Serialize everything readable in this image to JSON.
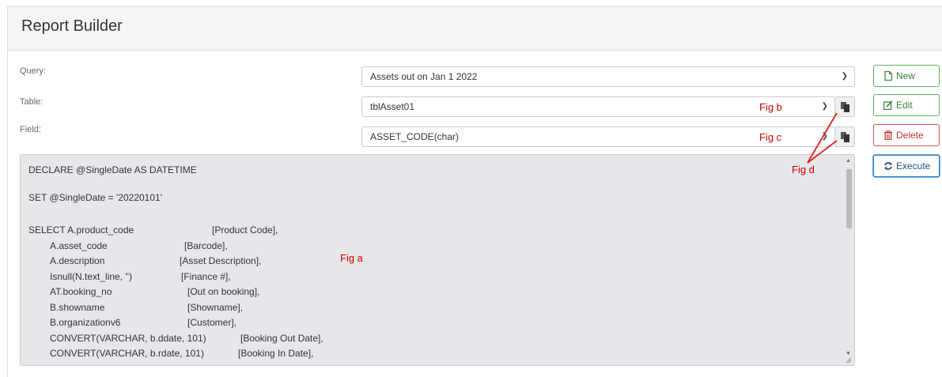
{
  "panel": {
    "title": "Report Builder"
  },
  "form": {
    "query_label": "Query:",
    "query_value": "Assets out on Jan 1 2022",
    "table_label": "Table:",
    "table_value": "tblAsset01",
    "field_label": "Field:",
    "field_value": "ASSET_CODE(char)"
  },
  "buttons": {
    "new": "New",
    "edit": "Edit",
    "delete": "Delete",
    "execute": "Execute"
  },
  "annotations": {
    "fig_a": "Fig a",
    "fig_b": "Fig b",
    "fig_c": "Fig c",
    "fig_d": "Fig d"
  },
  "code": {
    "lines": [
      {
        "col1": "DECLARE @SingleDate AS DATETIME",
        "col2": ""
      },
      {
        "col1": "SET @SingleDate = '20220101'",
        "col2": ""
      },
      {
        "col1": "SELECT A.product_code",
        "col2": "[Product Code],"
      },
      {
        "col1": "A.asset_code",
        "col2": "[Barcode],"
      },
      {
        "col1": "A.description",
        "col2": "[Asset Description],"
      },
      {
        "col1": "Isnull(N.text_line, '')",
        "col2": "[Finance #],"
      },
      {
        "col1": "AT.booking_no",
        "col2": "[Out on booking],"
      },
      {
        "col1": "B.showname",
        "col2": "[Showname],"
      },
      {
        "col1": "B.organizationv6",
        "col2": "[Customer],"
      },
      {
        "col1": "CONVERT(VARCHAR, b.ddate, 101)",
        "col2": "[Booking Out Date],"
      },
      {
        "col1": "CONVERT(VARCHAR, b.rdate, 101)",
        "col2": "[Booking In Date],"
      }
    ]
  },
  "colors": {
    "annotation": "#cc0000",
    "success": "#5cb85c",
    "danger": "#d9534f",
    "primary": "#337ab7"
  },
  "icons": {
    "new": "file-icon",
    "edit": "edit-icon",
    "delete": "trash-icon",
    "execute": "refresh-icon",
    "copy": "copy-icon"
  }
}
